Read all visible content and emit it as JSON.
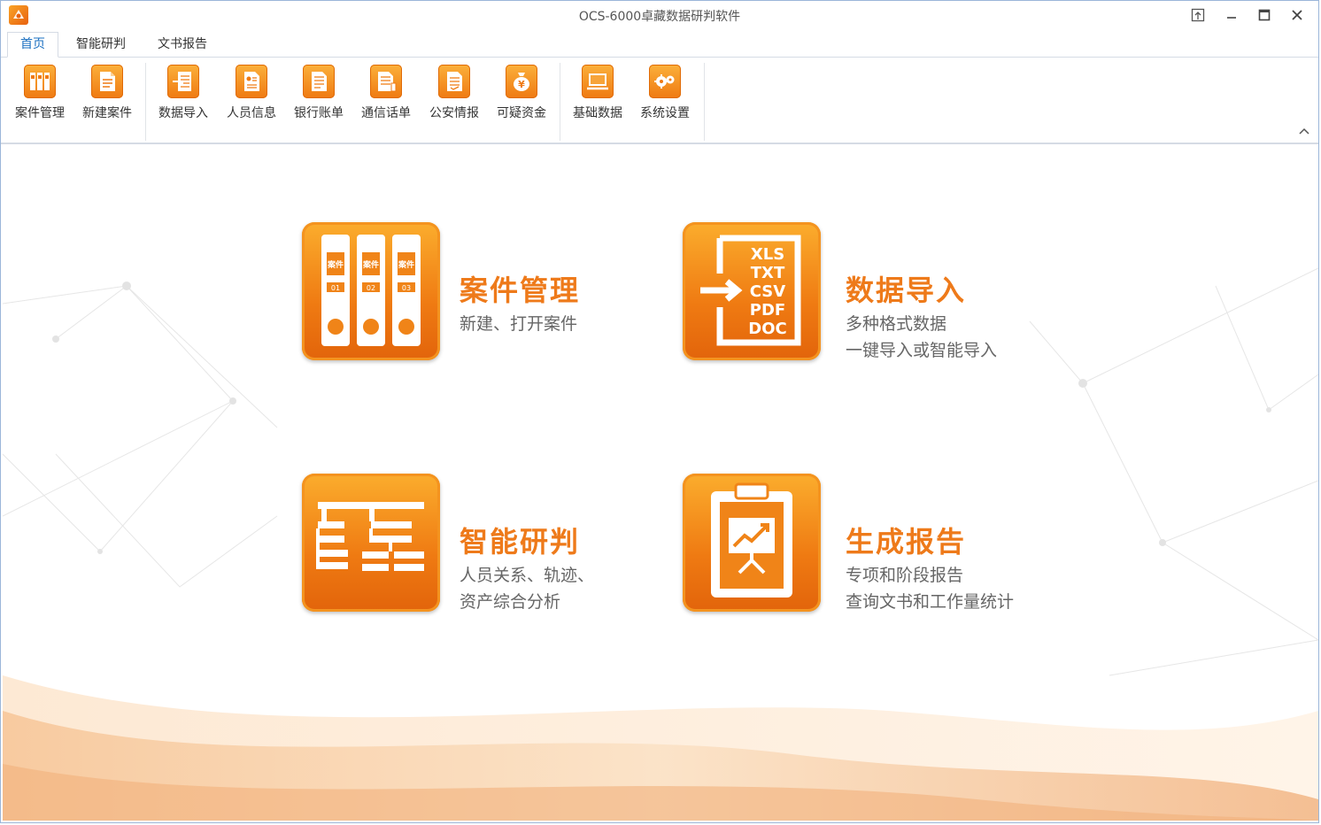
{
  "window": {
    "title": "OCS-6000卓藏数据研判软件"
  },
  "tabs": [
    {
      "label": "首页",
      "active": true
    },
    {
      "label": "智能研判",
      "active": false
    },
    {
      "label": "文书报告",
      "active": false
    }
  ],
  "ribbon": {
    "buttons": [
      {
        "label": "案件管理",
        "icon": "binders-icon"
      },
      {
        "label": "新建案件",
        "icon": "new-document-icon"
      },
      {
        "label": "数据导入",
        "icon": "import-icon"
      },
      {
        "label": "人员信息",
        "icon": "person-doc-icon"
      },
      {
        "label": "银行账单",
        "icon": "bank-doc-icon"
      },
      {
        "label": "通信话单",
        "icon": "phone-doc-icon"
      },
      {
        "label": "公安情报",
        "icon": "police-doc-icon"
      },
      {
        "label": "可疑资金",
        "icon": "money-bag-icon"
      },
      {
        "label": "基础数据",
        "icon": "monitor-icon"
      },
      {
        "label": "系统设置",
        "icon": "gears-icon"
      }
    ]
  },
  "tiles": {
    "case": {
      "title": "案件管理",
      "lines": [
        "新建、打开案件"
      ]
    },
    "import": {
      "title": "数据导入",
      "lines": [
        "多种格式数据",
        "一键导入或智能导入"
      ],
      "formats": [
        "XLS",
        "TXT",
        "CSV",
        "PDF",
        "DOC"
      ]
    },
    "analysis": {
      "title": "智能研判",
      "lines": [
        "人员关系、轨迹、",
        "资产综合分析"
      ]
    },
    "report": {
      "title": "生成报告",
      "lines": [
        "专项和阶段报告",
        "查询文书和工作量统计"
      ]
    }
  },
  "binder_labels": [
    "案件",
    "案件",
    "案件"
  ],
  "binder_numbers": [
    "01",
    "02",
    "03"
  ],
  "colors": {
    "accent": "#ee7a1a",
    "tab_active": "#1a6fc0",
    "tile_top": "#fbad2d",
    "tile_bottom": "#e2640b"
  }
}
